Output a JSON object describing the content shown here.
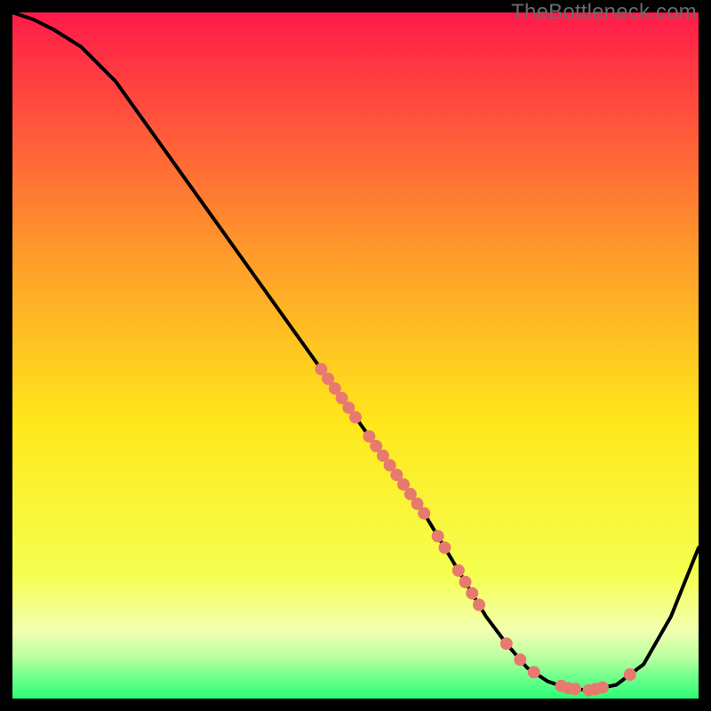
{
  "watermark": "TheBottleneck.com",
  "colors": {
    "gradient_top": "#ff1a4a",
    "gradient_mid1": "#ff7a2a",
    "gradient_mid2": "#ffe81a",
    "gradient_mid3": "#f5ff50",
    "gradient_bottom_yellow": "#f2ffb0",
    "gradient_green1": "#9dff7a",
    "gradient_green2": "#2bff77",
    "frame_border": "#000000",
    "curve": "#000000",
    "marker": "#e77a6e"
  },
  "chart_data": {
    "type": "line",
    "title": "",
    "xlabel": "",
    "ylabel": "",
    "xlim": [
      0,
      100
    ],
    "ylim": [
      0,
      100
    ],
    "x": [
      0,
      3,
      6,
      10,
      15,
      20,
      25,
      30,
      35,
      40,
      45,
      50,
      55,
      60,
      63,
      66,
      69,
      72,
      75,
      78,
      81,
      84,
      88,
      92,
      96,
      100
    ],
    "y": [
      100,
      99,
      97.5,
      95,
      90,
      83,
      76,
      69,
      62,
      55,
      48,
      41,
      34,
      27,
      22,
      17,
      12,
      8,
      4.5,
      2.5,
      1.5,
      1.2,
      2,
      5,
      12,
      22
    ],
    "markers_on_curve_x": [
      45,
      46,
      47,
      48,
      49,
      50,
      52,
      53,
      54,
      55,
      56,
      57,
      58,
      59,
      60,
      62,
      63,
      65,
      66,
      67,
      68,
      72,
      74,
      76,
      80,
      81,
      82,
      84,
      85,
      86,
      90
    ],
    "legend": []
  }
}
